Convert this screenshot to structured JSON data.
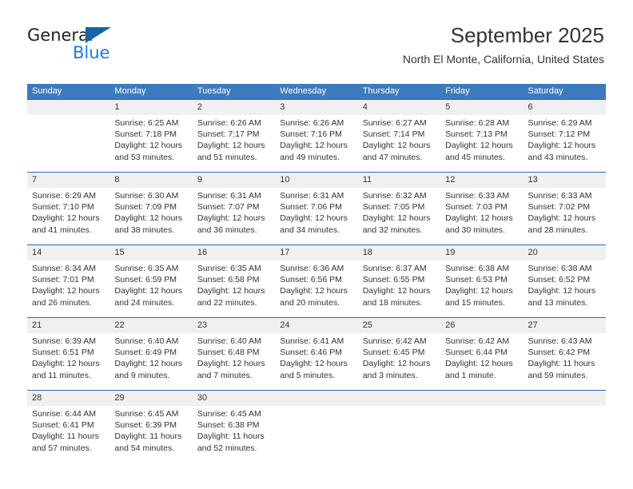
{
  "brand": {
    "name_dark": "General",
    "name_blue": "Blue",
    "logo_color": "#1565a8",
    "blue_text_color": "#1a7fd4"
  },
  "header": {
    "title": "September 2025",
    "subtitle": "North El Monte, California, United States"
  },
  "theme": {
    "header_row_bg": "#3b7bbf",
    "header_row_text": "#ffffff",
    "daynum_row_bg": "#f0f0f0",
    "week_divider": "#2f6ba6",
    "body_text": "#333333"
  },
  "weekdays": [
    "Sunday",
    "Monday",
    "Tuesday",
    "Wednesday",
    "Thursday",
    "Friday",
    "Saturday"
  ],
  "weeks": [
    {
      "numbers": [
        "",
        "1",
        "2",
        "3",
        "4",
        "5",
        "6"
      ],
      "cells": [
        {
          "l1": "",
          "l2": "",
          "l3": "",
          "l4": ""
        },
        {
          "l1": "Sunrise: 6:25 AM",
          "l2": "Sunset: 7:18 PM",
          "l3": "Daylight: 12 hours",
          "l4": "and 53 minutes."
        },
        {
          "l1": "Sunrise: 6:26 AM",
          "l2": "Sunset: 7:17 PM",
          "l3": "Daylight: 12 hours",
          "l4": "and 51 minutes."
        },
        {
          "l1": "Sunrise: 6:26 AM",
          "l2": "Sunset: 7:16 PM",
          "l3": "Daylight: 12 hours",
          "l4": "and 49 minutes."
        },
        {
          "l1": "Sunrise: 6:27 AM",
          "l2": "Sunset: 7:14 PM",
          "l3": "Daylight: 12 hours",
          "l4": "and 47 minutes."
        },
        {
          "l1": "Sunrise: 6:28 AM",
          "l2": "Sunset: 7:13 PM",
          "l3": "Daylight: 12 hours",
          "l4": "and 45 minutes."
        },
        {
          "l1": "Sunrise: 6:29 AM",
          "l2": "Sunset: 7:12 PM",
          "l3": "Daylight: 12 hours",
          "l4": "and 43 minutes."
        }
      ]
    },
    {
      "numbers": [
        "7",
        "8",
        "9",
        "10",
        "11",
        "12",
        "13"
      ],
      "cells": [
        {
          "l1": "Sunrise: 6:29 AM",
          "l2": "Sunset: 7:10 PM",
          "l3": "Daylight: 12 hours",
          "l4": "and 41 minutes."
        },
        {
          "l1": "Sunrise: 6:30 AM",
          "l2": "Sunset: 7:09 PM",
          "l3": "Daylight: 12 hours",
          "l4": "and 38 minutes."
        },
        {
          "l1": "Sunrise: 6:31 AM",
          "l2": "Sunset: 7:07 PM",
          "l3": "Daylight: 12 hours",
          "l4": "and 36 minutes."
        },
        {
          "l1": "Sunrise: 6:31 AM",
          "l2": "Sunset: 7:06 PM",
          "l3": "Daylight: 12 hours",
          "l4": "and 34 minutes."
        },
        {
          "l1": "Sunrise: 6:32 AM",
          "l2": "Sunset: 7:05 PM",
          "l3": "Daylight: 12 hours",
          "l4": "and 32 minutes."
        },
        {
          "l1": "Sunrise: 6:33 AM",
          "l2": "Sunset: 7:03 PM",
          "l3": "Daylight: 12 hours",
          "l4": "and 30 minutes."
        },
        {
          "l1": "Sunrise: 6:33 AM",
          "l2": "Sunset: 7:02 PM",
          "l3": "Daylight: 12 hours",
          "l4": "and 28 minutes."
        }
      ]
    },
    {
      "numbers": [
        "14",
        "15",
        "16",
        "17",
        "18",
        "19",
        "20"
      ],
      "cells": [
        {
          "l1": "Sunrise: 6:34 AM",
          "l2": "Sunset: 7:01 PM",
          "l3": "Daylight: 12 hours",
          "l4": "and 26 minutes."
        },
        {
          "l1": "Sunrise: 6:35 AM",
          "l2": "Sunset: 6:59 PM",
          "l3": "Daylight: 12 hours",
          "l4": "and 24 minutes."
        },
        {
          "l1": "Sunrise: 6:35 AM",
          "l2": "Sunset: 6:58 PM",
          "l3": "Daylight: 12 hours",
          "l4": "and 22 minutes."
        },
        {
          "l1": "Sunrise: 6:36 AM",
          "l2": "Sunset: 6:56 PM",
          "l3": "Daylight: 12 hours",
          "l4": "and 20 minutes."
        },
        {
          "l1": "Sunrise: 6:37 AM",
          "l2": "Sunset: 6:55 PM",
          "l3": "Daylight: 12 hours",
          "l4": "and 18 minutes."
        },
        {
          "l1": "Sunrise: 6:38 AM",
          "l2": "Sunset: 6:53 PM",
          "l3": "Daylight: 12 hours",
          "l4": "and 15 minutes."
        },
        {
          "l1": "Sunrise: 6:38 AM",
          "l2": "Sunset: 6:52 PM",
          "l3": "Daylight: 12 hours",
          "l4": "and 13 minutes."
        }
      ]
    },
    {
      "numbers": [
        "21",
        "22",
        "23",
        "24",
        "25",
        "26",
        "27"
      ],
      "cells": [
        {
          "l1": "Sunrise: 6:39 AM",
          "l2": "Sunset: 6:51 PM",
          "l3": "Daylight: 12 hours",
          "l4": "and 11 minutes."
        },
        {
          "l1": "Sunrise: 6:40 AM",
          "l2": "Sunset: 6:49 PM",
          "l3": "Daylight: 12 hours",
          "l4": "and 9 minutes."
        },
        {
          "l1": "Sunrise: 6:40 AM",
          "l2": "Sunset: 6:48 PM",
          "l3": "Daylight: 12 hours",
          "l4": "and 7 minutes."
        },
        {
          "l1": "Sunrise: 6:41 AM",
          "l2": "Sunset: 6:46 PM",
          "l3": "Daylight: 12 hours",
          "l4": "and 5 minutes."
        },
        {
          "l1": "Sunrise: 6:42 AM",
          "l2": "Sunset: 6:45 PM",
          "l3": "Daylight: 12 hours",
          "l4": "and 3 minutes."
        },
        {
          "l1": "Sunrise: 6:42 AM",
          "l2": "Sunset: 6:44 PM",
          "l3": "Daylight: 12 hours",
          "l4": "and 1 minute."
        },
        {
          "l1": "Sunrise: 6:43 AM",
          "l2": "Sunset: 6:42 PM",
          "l3": "Daylight: 11 hours",
          "l4": "and 59 minutes."
        }
      ]
    },
    {
      "numbers": [
        "28",
        "29",
        "30",
        "",
        "",
        "",
        ""
      ],
      "cells": [
        {
          "l1": "Sunrise: 6:44 AM",
          "l2": "Sunset: 6:41 PM",
          "l3": "Daylight: 11 hours",
          "l4": "and 57 minutes."
        },
        {
          "l1": "Sunrise: 6:45 AM",
          "l2": "Sunset: 6:39 PM",
          "l3": "Daylight: 11 hours",
          "l4": "and 54 minutes."
        },
        {
          "l1": "Sunrise: 6:45 AM",
          "l2": "Sunset: 6:38 PM",
          "l3": "Daylight: 11 hours",
          "l4": "and 52 minutes."
        },
        {
          "l1": "",
          "l2": "",
          "l3": "",
          "l4": ""
        },
        {
          "l1": "",
          "l2": "",
          "l3": "",
          "l4": ""
        },
        {
          "l1": "",
          "l2": "",
          "l3": "",
          "l4": ""
        },
        {
          "l1": "",
          "l2": "",
          "l3": "",
          "l4": ""
        }
      ]
    }
  ]
}
